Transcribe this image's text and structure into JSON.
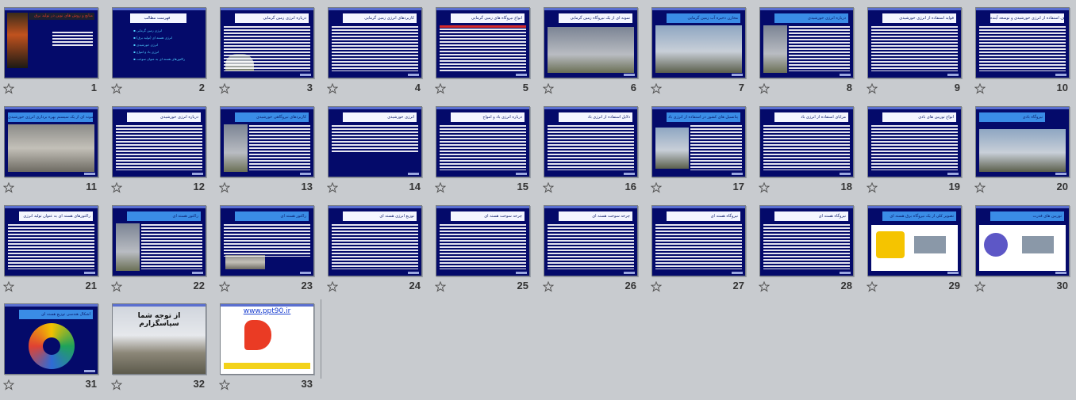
{
  "slides": [
    {
      "n": "1",
      "title": "منابع و روش های نوین در تولید برق",
      "sub": "ارائه دهنده: ...",
      "variant": "cover"
    },
    {
      "n": "2",
      "title": "فهرست مطالب",
      "variant": "toc",
      "items": [
        "انرژی زمین گرمایی",
        "انرژی هسته ای (تولید برق)",
        "انرژی خورشیدی",
        "انرژی باد و امواج",
        "راکتورهای هسته ای به عنوان سوخت"
      ]
    },
    {
      "n": "3",
      "title": "درباره انرژی زمین گرمایی",
      "variant": "text-pic"
    },
    {
      "n": "4",
      "title": "کاربردهای انرژی زمین گرمایی",
      "variant": "text"
    },
    {
      "n": "5",
      "title": "انواع نیروگاه های زمین گرمایی",
      "variant": "text-red"
    },
    {
      "n": "6",
      "title": "نمونه ای از یک نیروگاه زمین گرمایی",
      "variant": "photo"
    },
    {
      "n": "7",
      "title": "مخازن ذخیره آب زمین گرمایی",
      "variant": "photo2"
    },
    {
      "n": "8",
      "title": "درباره انرژی خورشیدی",
      "variant": "text-pic-left"
    },
    {
      "n": "9",
      "title": "فواید استفاده از انرژی خورشیدی",
      "variant": "text"
    },
    {
      "n": "10",
      "title": "مصارف استفاده از انرژی خورشیدی و توسعه آینده",
      "variant": "text"
    },
    {
      "n": "11",
      "title": "نمونه ای از یک سیستم بهره برداری انرژی خورشیدی",
      "variant": "photo-factory"
    },
    {
      "n": "12",
      "title": "درباره انرژی خورشیدی",
      "variant": "text"
    },
    {
      "n": "13",
      "title": "کاربردهای نیروگاهی خورشیدی",
      "variant": "text-pic-left"
    },
    {
      "n": "14",
      "title": "انرژی خورشیدی",
      "variant": "text-short"
    },
    {
      "n": "15",
      "title": "درباره انرژی باد و امواج",
      "variant": "text"
    },
    {
      "n": "16",
      "title": "دلایل استفاده از انرژی باد",
      "variant": "text"
    },
    {
      "n": "17",
      "title": "پتانسیل های کشور در استفاده از انرژی باد",
      "variant": "text-turbine"
    },
    {
      "n": "18",
      "title": "مزایای استفاده از انرژی باد",
      "variant": "text"
    },
    {
      "n": "19",
      "title": "انواع توربین های بادی",
      "variant": "text"
    },
    {
      "n": "20",
      "title": "نیروگاه بادی",
      "variant": "photo-wind"
    },
    {
      "n": "21",
      "title": "راکتورهای هسته ای به عنوان تولید انرژی",
      "variant": "text"
    },
    {
      "n": "22",
      "title": "راکتور هسته ای",
      "variant": "text-pic-left"
    },
    {
      "n": "23",
      "title": "راکتور هسته ای",
      "variant": "text-pic-bottom"
    },
    {
      "n": "24",
      "title": "توزیع انرژی هسته ای",
      "variant": "text"
    },
    {
      "n": "25",
      "title": "چرخه سوخت هسته ای",
      "variant": "text"
    },
    {
      "n": "26",
      "title": "چرخه سوخت هسته ای",
      "variant": "text"
    },
    {
      "n": "27",
      "title": "نیروگاه هسته ای",
      "variant": "text"
    },
    {
      "n": "28",
      "title": "نیروگاه هسته ای",
      "variant": "text"
    },
    {
      "n": "29",
      "title": "تصویر کلی از یک نیروگاه برق هسته ای",
      "variant": "diagram"
    },
    {
      "n": "30",
      "title": "توربین های قدرت",
      "variant": "diagram2"
    },
    {
      "n": "31",
      "title": "اشکال هندسی توزیع هسته ای",
      "variant": "ring"
    },
    {
      "n": "32",
      "title": "از توجه شما سپاسگزارم",
      "variant": "thanks"
    },
    {
      "n": "33",
      "title": "www.ppt90.ir",
      "variant": "logo"
    }
  ]
}
